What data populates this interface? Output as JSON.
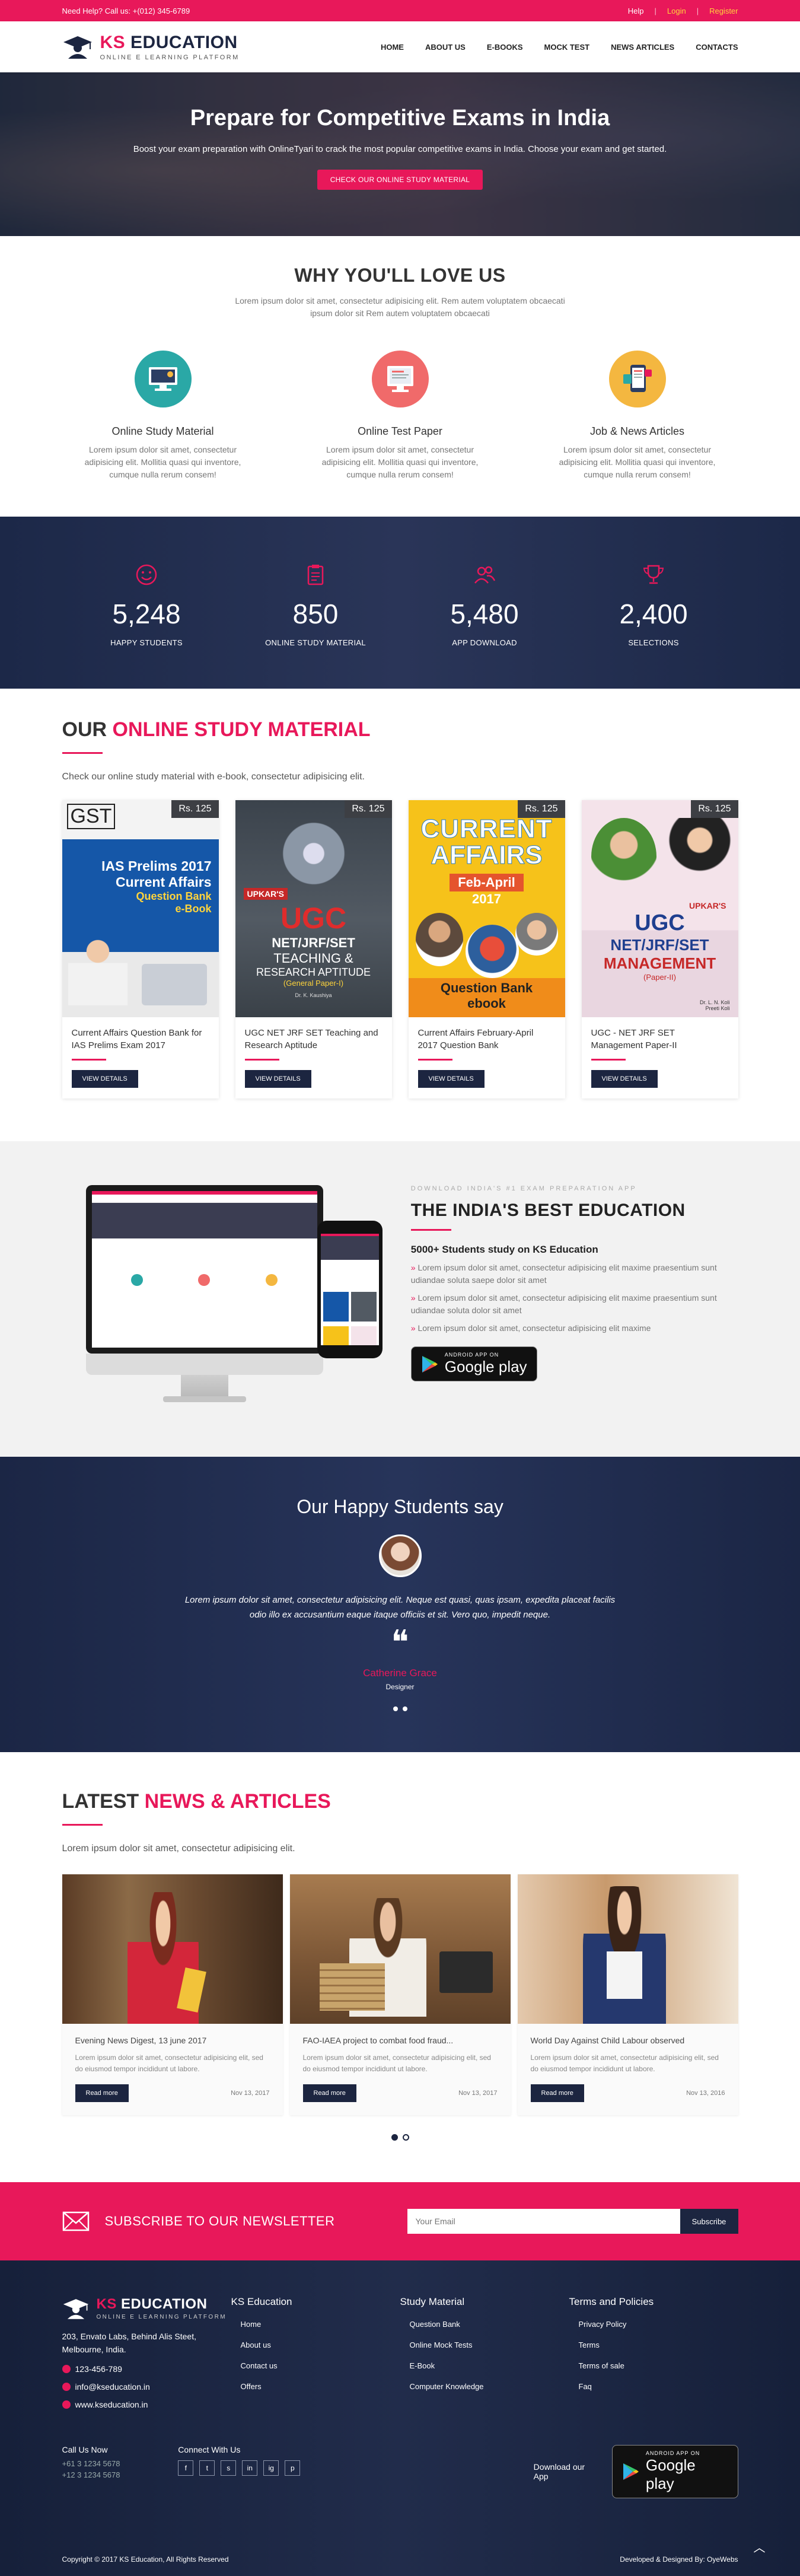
{
  "topbar": {
    "help": "Need Help? Call us: +(012) 345-6789",
    "links": {
      "help": "Help",
      "sep": "|",
      "login": "Login",
      "register": "Register"
    }
  },
  "brand": {
    "prefix": "KS",
    "name": "EDUCATION",
    "tagline": "ONLINE E LEARNING PLATFORM"
  },
  "nav": [
    "HOME",
    "ABOUT US",
    "E-BOOKS",
    "MOCK TEST",
    "NEWS ARTICLES",
    "CONTACTS"
  ],
  "hero": {
    "title": "Prepare for Competitive Exams in India",
    "subtitle": "Boost your exam preparation with OnlineTyari to crack the most popular competitive exams in India. Choose your exam and get started.",
    "cta": "CHECK OUR ONLINE STUDY MATERIAL"
  },
  "why": {
    "title": "WHY YOU'LL LOVE US",
    "sub": "Lorem ipsum dolor sit amet, consectetur adipisicing elit. Rem autem voluptatem obcaecati ipsum dolor sit Rem autem voluptatem obcaecati",
    "features": [
      {
        "title": "Online Study Material",
        "text": "Lorem ipsum dolor sit amet, consectetur adipisicing elit. Mollitia quasi qui inventore, cumque nulla rerum consem!",
        "icon": "study-material-icon",
        "color": "#2aa8a6"
      },
      {
        "title": "Online Test Paper",
        "text": "Lorem ipsum dolor sit amet, consectetur adipisicing elit. Mollitia quasi qui inventore, cumque nulla rerum consem!",
        "icon": "test-paper-icon",
        "color": "#f06a6a"
      },
      {
        "title": "Job & News Articles",
        "text": "Lorem ipsum dolor sit amet, consectetur adipisicing elit. Mollitia quasi qui inventore, cumque nulla rerum consem!",
        "icon": "news-articles-icon",
        "color": "#f4b740"
      }
    ]
  },
  "stats": [
    {
      "value": "5,248",
      "label": "HAPPY STUDENTS",
      "icon": "smile-icon"
    },
    {
      "value": "850",
      "label": "ONLINE STUDY MATERIAL",
      "icon": "clipboard-icon"
    },
    {
      "value": "5,480",
      "label": "APP DOWNLOAD",
      "icon": "users-icon"
    },
    {
      "value": "2,400",
      "label": "SELECTIONS",
      "icon": "trophy-icon"
    }
  ],
  "study": {
    "title_plain": "OUR ",
    "title_accent": "ONLINE STUDY MATERIAL",
    "lead": "Check our online study material with e-book, consectetur adipisicing elit.",
    "button": "VIEW DETAILS",
    "books": [
      {
        "price": "Rs. 125",
        "title": "Current Affairs Question Bank for IAS Prelims Exam 2017",
        "cover": {
          "top": "GST",
          "line1": "IAS Prelims 2017",
          "line2": "Current Affairs",
          "line3": "Question Bank",
          "line4": "e-Book"
        }
      },
      {
        "price": "Rs. 125",
        "title": "UGC NET JRF SET Teaching and Research Aptitude",
        "cover": {
          "top": "UPKAR'S",
          "line1": "UGC",
          "line2": "NET/JRF/SET",
          "line3": "TEACHING &",
          "line4": "RESEARCH APTITUDE",
          "line5": "(General Paper-I)",
          "line6": "Dr. K. Kaushiya"
        }
      },
      {
        "price": "Rs. 125",
        "title": "Current Affairs February-April 2017 Question Bank",
        "cover": {
          "line1": "CURRENT",
          "line2": "AFFAIRS",
          "line3": "Feb-April",
          "line4": "2017",
          "line5": "Question Bank",
          "line6": "ebook"
        }
      },
      {
        "price": "Rs. 125",
        "title": "UGC - NET JRF SET Management Paper-II",
        "cover": {
          "top": "UPKAR'S",
          "line1": "UGC",
          "line2": "NET/JRF/SET",
          "line3": "MANAGEMENT",
          "line4": "(Paper-II)",
          "line5": "Dr. L. N. Koli",
          "line6": "Preeti Koli"
        }
      }
    ]
  },
  "app": {
    "kicker": "DOWNLOAD INDIA'S #1 EXAM PREPARATION APP",
    "title": "THE INDIA'S BEST EDUCATION",
    "subtitle": "5000+ Students study on KS Education",
    "points": [
      "Lorem ipsum dolor sit amet, consectetur adipisicing elit maxime praesentium sunt udiandae soluta saepe dolor sit amet",
      "Lorem ipsum dolor sit amet, consectetur adipisicing elit maxime praesentium sunt udiandae soluta dolor sit amet",
      "Lorem ipsum dolor sit amet, consectetur adipisicing elit maxime"
    ],
    "store_small": "ANDROID APP ON",
    "store_big": "Google play"
  },
  "testimonial": {
    "title": "Our Happy Students say",
    "quote": "Lorem ipsum dolor sit amet, consectetur adipisicing elit. Neque est quasi, quas ipsam, expedita placeat facilis odio illo ex accusantium eaque itaque officiis et sit. Vero quo, impedit neque.",
    "qmark": "❝",
    "name": "Catherine Grace",
    "role": "Designer"
  },
  "news": {
    "title_plain": "LATEST ",
    "title_accent": "NEWS & ARTICLES",
    "lead": "Lorem ipsum dolor sit amet, consectetur adipisicing elit.",
    "button": "Read more",
    "items": [
      {
        "title": "Evening News Digest, 13 june 2017",
        "desc": "Lorem ipsum dolor sit amet, consectetur adipisicing elit, sed do eiusmod tempor incididunt ut labore.",
        "date": "Nov 13, 2017"
      },
      {
        "title": "FAO-IAEA project to combat food fraud...",
        "desc": "Lorem ipsum dolor sit amet, consectetur adipisicing elit, sed do eiusmod tempor incididunt ut labore.",
        "date": "Nov 13, 2017"
      },
      {
        "title": "World Day Against Child Labour observed",
        "desc": "Lorem ipsum dolor sit amet, consectetur adipisicing elit, sed do eiusmod tempor incididunt ut labore.",
        "date": "Nov 13, 2016"
      }
    ]
  },
  "newsletter": {
    "title": "SUBSCRIBE TO OUR NEWSLETTER",
    "placeholder": "Your Email",
    "button": "Subscribe"
  },
  "footer": {
    "address": "203, Envato Labs, Behind Alis Steet, Melbourne, India.",
    "phone": "123-456-789",
    "email": "info@kseducation.in",
    "web": "www.kseducation.in",
    "cols": [
      {
        "title": "KS Education",
        "items": [
          "Home",
          "About us",
          "Contact us",
          "Offers"
        ]
      },
      {
        "title": "Study Material",
        "items": [
          "Question Bank",
          "Online Mock Tests",
          "E-Book",
          "Computer Knowledge"
        ]
      },
      {
        "title": "Terms and Policies",
        "items": [
          "Privacy Policy",
          "Terms",
          "Terms of sale",
          "Faq"
        ]
      }
    ],
    "call_title": "Call Us Now",
    "call_numbers": [
      "+61 3 1234 5678",
      "+12 3 1234 5678"
    ],
    "connect_title": "Connect With Us",
    "socials": [
      "f",
      "t",
      "s",
      "in",
      "ig",
      "p"
    ],
    "app_label": "Download our App",
    "copyright": "Copyright © 2017 KS Education, All Rights Reserved",
    "credit": "Developed & Designed By: OyeWebs"
  }
}
